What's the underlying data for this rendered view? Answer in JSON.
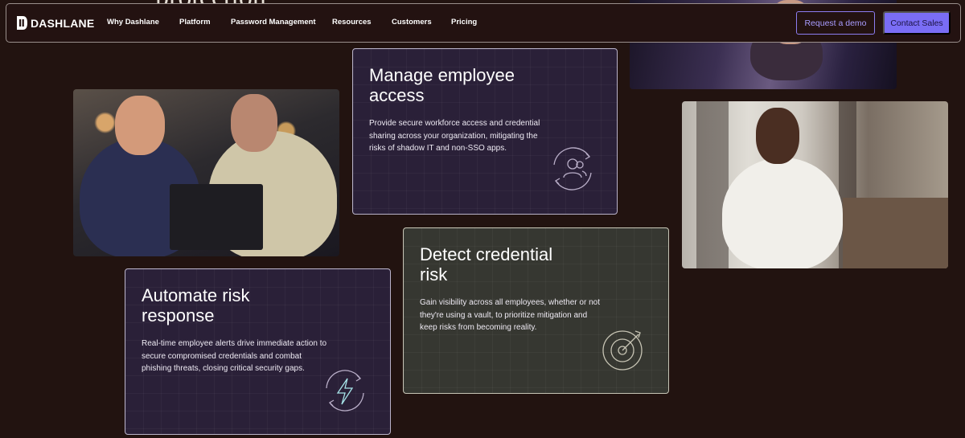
{
  "hero": {
    "heading_peek": "protection"
  },
  "nav": {
    "logo_text": "DASHLANE",
    "links": [
      "Why Dashlane",
      "Platform",
      "Password Management",
      "Resources",
      "Customers",
      "Pricing"
    ],
    "request_demo": "Request a demo",
    "contact_sales": "Contact Sales"
  },
  "cards": [
    {
      "title_line1": "Manage employee",
      "title_line2": "access",
      "body": "Provide secure workforce access and credential sharing across your organization, mitigating the risks of shadow IT and non-SSO apps.",
      "icon": "users-cycle-icon"
    },
    {
      "title_line1": "Detect credential",
      "title_line2": "risk",
      "body": "Gain visibility across all employees, whether or not they're using a vault, to prioritize mitigation and keep risks from becoming reality.",
      "icon": "radar-icon"
    },
    {
      "title_line1": "Automate risk",
      "title_line2": "response",
      "body": "Real-time employee alerts drive immediate action to secure compromised credentials and combat phishing threats, closing critical security gaps.",
      "icon": "lightning-cycle-icon"
    }
  ],
  "colors": {
    "background": "#221310",
    "accent": "#7a6df5",
    "card_purple": "#2a2038",
    "card_green": "#363731"
  }
}
